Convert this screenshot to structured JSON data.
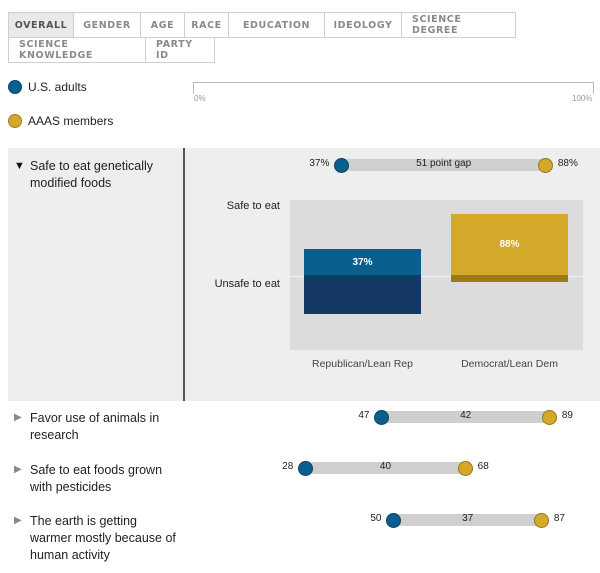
{
  "tabs": {
    "row1": [
      "OVERALL",
      "GENDER",
      "AGE",
      "RACE",
      "EDUCATION",
      "IDEOLOGY",
      "SCIENCE DEGREE"
    ],
    "row2": [
      "SCIENCE KNOWLEDGE",
      "PARTY ID"
    ],
    "active": "OVERALL"
  },
  "legend": {
    "us_adults": {
      "label": "U.S. adults",
      "color": "#0b5f8f"
    },
    "aaas": {
      "label": "AAAS members",
      "color": "#d4a92a"
    }
  },
  "axis": {
    "min_label": "0%",
    "max_label": "100%"
  },
  "chart_data": {
    "type": "dot-range",
    "xlim": [
      0,
      100
    ],
    "series": [
      {
        "name": "U.S. adults",
        "color": "#0b5f8f"
      },
      {
        "name": "AAAS members",
        "color": "#d4a92a"
      }
    ],
    "rows": [
      {
        "label": "Safe to eat genetically modified foods",
        "us": 37,
        "aaas": 88,
        "us_text": "37%",
        "aaas_text": "88%",
        "gap_text": "51 point gap",
        "expanded": true
      },
      {
        "label": "Favor use of animals in research",
        "us": 47,
        "aaas": 89,
        "us_text": "47",
        "aaas_text": "89",
        "gap_text": "42",
        "expanded": false
      },
      {
        "label": "Safe to eat foods grown with pesticides",
        "us": 28,
        "aaas": 68,
        "us_text": "28",
        "aaas_text": "68",
        "gap_text": "40",
        "expanded": false
      },
      {
        "label": "The earth is getting warmer mostly because of human activity",
        "us": 50,
        "aaas": 87,
        "us_text": "50",
        "aaas_text": "87",
        "gap_text": "37",
        "expanded": false
      }
    ],
    "detail": {
      "ylabels": {
        "top": "Safe to eat",
        "bottom": "Unsafe to eat"
      },
      "categories": [
        "Republican/Lean Rep",
        "Democrat/Lean Dem"
      ],
      "values": [
        37,
        88
      ],
      "value_labels": [
        "37%",
        "88%"
      ],
      "colors": {
        "rep_safe": "#0b5f8f",
        "rep_unsafe": "#143a63",
        "dem_safe": "#d4a92a",
        "dem_unsafe": "#9c7a18"
      }
    }
  }
}
